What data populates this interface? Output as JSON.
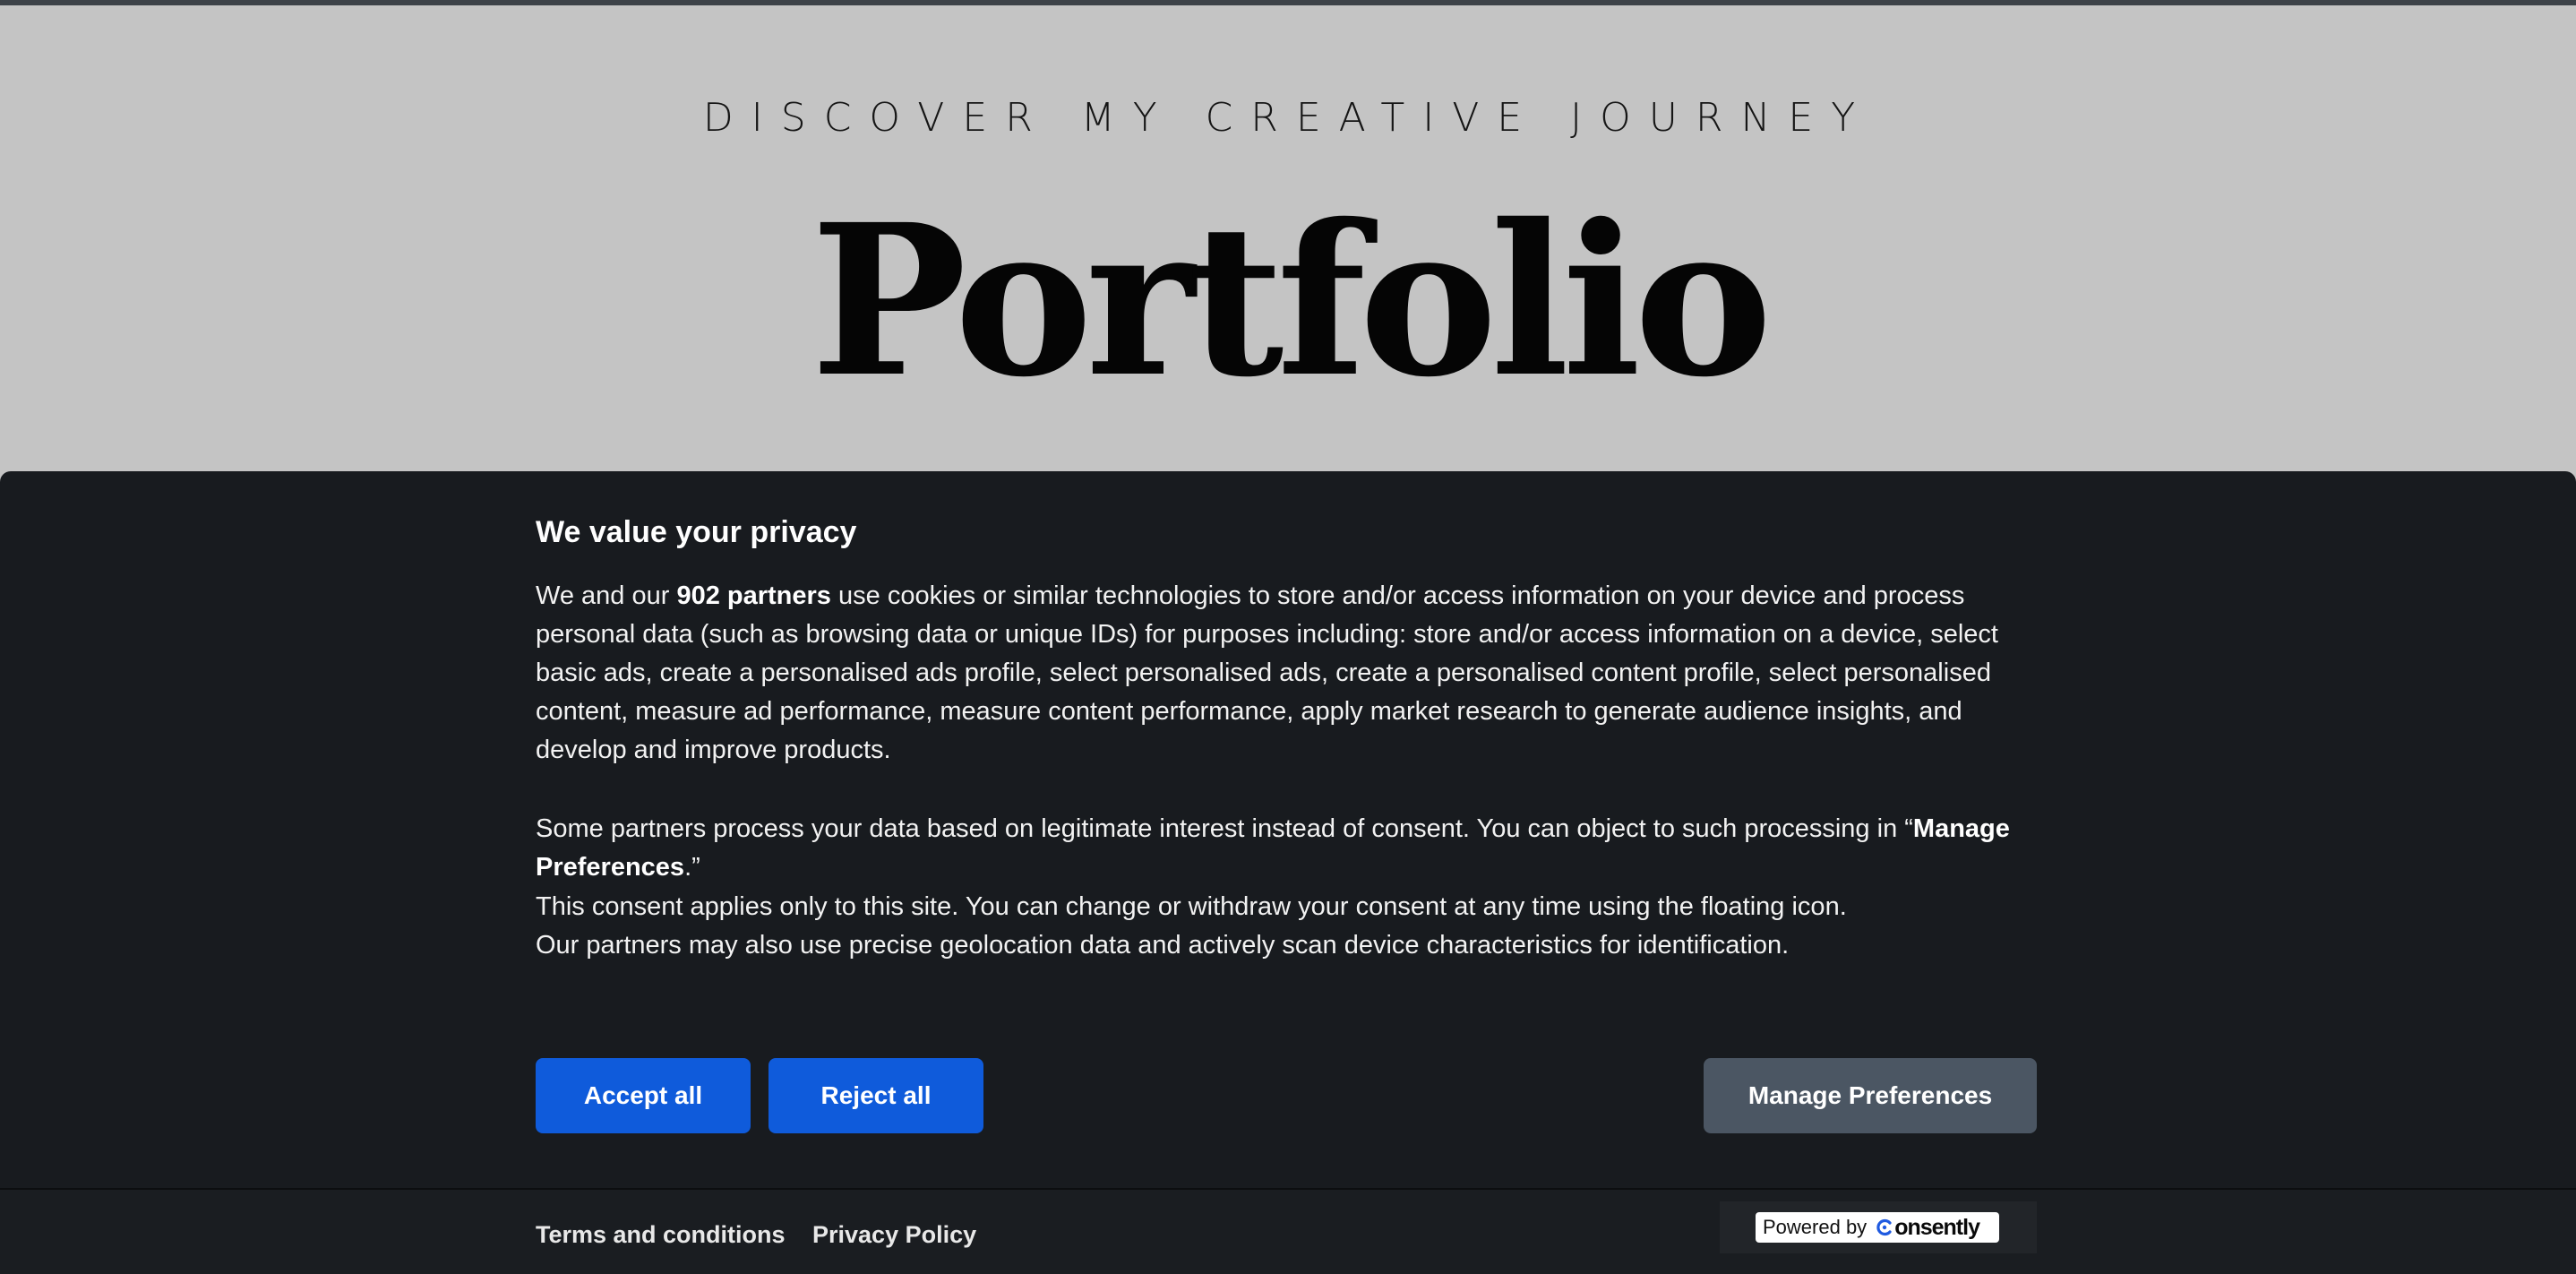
{
  "hero": {
    "eyebrow": "DISCOVER MY CREATIVE JOURNEY",
    "title": "Portfolio"
  },
  "consent": {
    "title": "We value your privacy",
    "p1_lead": "We and our ",
    "p1_partners": "902 partners",
    "p1_rest": " use cookies or similar technologies to store and/or access information on your device and process personal data (such as browsing data or unique IDs) for purposes including: store and/or access information on a device, select basic ads, create a personalised ads profile, select personalised ads, create a personalised content profile, select personalised content, measure ad performance, measure content performance, apply market research to generate audience insights, and develop and improve products.",
    "p2_lead": "Some partners process your data based on legitimate interest instead of consent. You can object to such processing in “",
    "p2_link": "Manage Preferences",
    "p2_tail": ".”",
    "p3_line1": "This consent applies only to this site. You can change or withdraw your consent at any time using the floating icon.",
    "p3_line2": "Our partners may also use precise geolocation data and actively scan device characteristics for identification.",
    "buttons": {
      "accept": "Accept all",
      "reject": "Reject all",
      "manage": "Manage Preferences"
    },
    "footer": {
      "terms": "Terms and conditions",
      "privacy": "Privacy Policy",
      "powered_by": "Powered by",
      "brand": "onsently",
      "brand_icon": "consently-c-icon"
    }
  },
  "colors": {
    "page_bg": "#c4c4c4",
    "banner_bg": "#181b1f",
    "primary_button": "#0f5bdb",
    "secondary_button": "#4b5663",
    "brand_blue": "#1f5ae0"
  }
}
